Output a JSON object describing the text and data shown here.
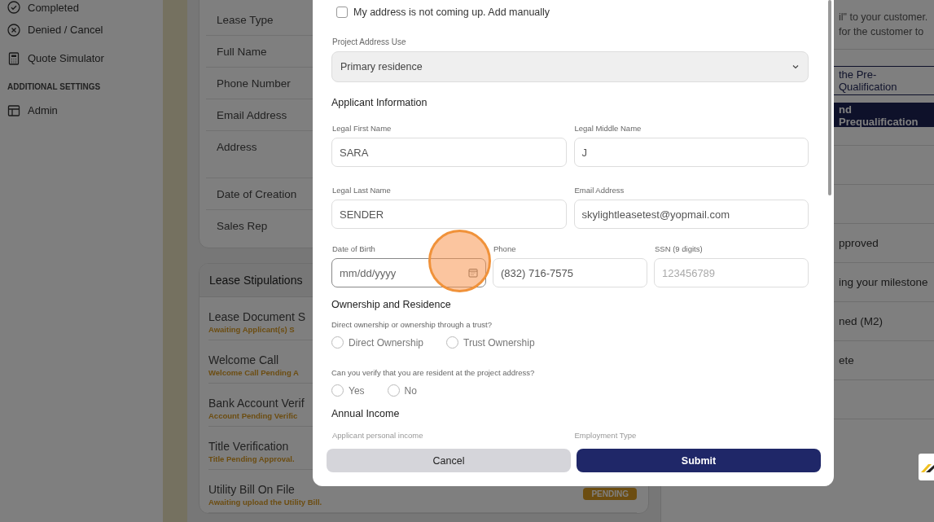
{
  "sidebar": {
    "items": [
      {
        "label": "Completed",
        "kind": "check"
      },
      {
        "label": "Denied / Cancel",
        "kind": "cross"
      },
      {
        "label": "Quote Simulator",
        "kind": "calculator"
      }
    ],
    "section_heading": "ADDITIONAL SETTINGS",
    "settings_items": [
      {
        "label": "Admin",
        "kind": "layout"
      }
    ]
  },
  "lease_details": {
    "rows": [
      {
        "label": "Lease Type",
        "tall": false
      },
      {
        "label": "Full Name",
        "tall": false
      },
      {
        "label": "Phone Number",
        "tall": false
      },
      {
        "label": "Email Address",
        "tall": false
      },
      {
        "label": "Address",
        "tall": true
      },
      {
        "label": "Date of Creation",
        "tall": false
      },
      {
        "label": "Sales Rep",
        "tall": false
      }
    ]
  },
  "lease_stipulations": {
    "title": "Lease Stipulations",
    "items": [
      {
        "title": "Lease Document S",
        "status": "Awaiting Applicant(s) S"
      },
      {
        "title": "Welcome Call",
        "status": "Welcome Call Pending A"
      },
      {
        "title": "Bank Account Verif",
        "status": "Account Pending Verific"
      },
      {
        "title": "Title Verification",
        "status": "Title Pending Approval."
      },
      {
        "title": "Utility Bill On File",
        "status": "Awaiting upload the Utility Bill.",
        "badge": "PENDING"
      }
    ]
  },
  "right_panel": {
    "text_lines": [
      "il\" to your customer.",
      "for the customer to"
    ],
    "outline_button": "the Pre-Qualification",
    "filled_button": "nd Prequalification",
    "rows": [
      "pproved",
      "ing your milestone",
      "ned (M2)",
      "ete"
    ]
  },
  "modal": {
    "manual_address": {
      "label": "My address is not coming up. Add manually",
      "checked": false
    },
    "project_address_use": {
      "label": "Project Address Use",
      "value": "Primary residence"
    },
    "applicant_heading": "Applicant Information",
    "fields": [
      {
        "label": "Legal First Name",
        "value": "SARA"
      },
      {
        "label": "Legal Middle Name",
        "value": "J"
      },
      {
        "label": "Legal Last Name",
        "value": "SENDER"
      },
      {
        "label": "Email Address",
        "value": "skylightleasetest@yopmail.com"
      }
    ],
    "fields_row": [
      {
        "label": "Date of Birth",
        "placeholder": "mm/dd/yyyy",
        "kind": "date"
      },
      {
        "label": "Phone",
        "value": "(832) 716-7575",
        "kind": "text"
      },
      {
        "label": "SSN (9 digits)",
        "placeholder": "123456789",
        "kind": "text"
      }
    ],
    "ownership_heading": "Ownership and Residence",
    "questions": [
      {
        "text": "Direct ownership or ownership through a trust?",
        "options": [
          {
            "label": "Direct Ownership",
            "selected": false
          },
          {
            "label": "Trust Ownership",
            "selected": false
          }
        ]
      },
      {
        "text": "Can you verify that you are resident at the project address?",
        "options": [
          {
            "label": "Yes",
            "selected": false
          },
          {
            "label": "No",
            "selected": false
          }
        ]
      }
    ],
    "income_heading": "Annual Income",
    "income_labels": [
      "Applicant personal income",
      "Employment Type"
    ],
    "buttons": [
      {
        "label": "Cancel",
        "kind": "secondary"
      },
      {
        "label": "Submit",
        "kind": "primary"
      }
    ]
  }
}
